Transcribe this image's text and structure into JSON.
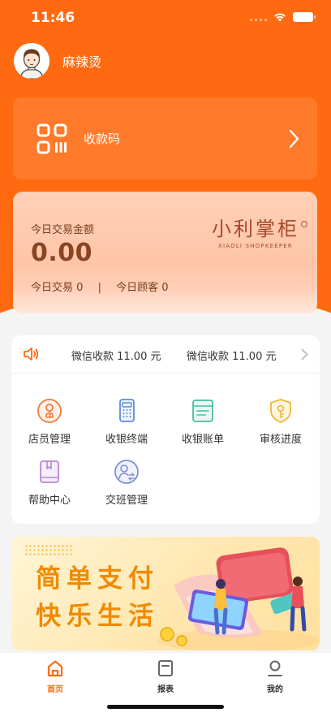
{
  "status_bar": {
    "time": "11:46"
  },
  "profile": {
    "name": "麻辣烫",
    "avatar_icon": "avatar-icon"
  },
  "qr_card": {
    "label": "收款码",
    "icon": "qr-code-icon"
  },
  "stats": {
    "amount_label": "今日交易金额",
    "amount": "0.00",
    "transactions_label": "今日交易",
    "transactions": "0",
    "customers_label": "今日顾客",
    "customers": "0",
    "separator": "|",
    "logo_cn": "小利掌柜",
    "logo_en": "XIAOLI SHOPKEEPER"
  },
  "notices": [
    "微信收款 11.00 元",
    "微信收款 11.00 元"
  ],
  "menu": [
    {
      "label": "店员管理",
      "icon": "staff-icon",
      "color": "#f07b3f"
    },
    {
      "label": "收银终端",
      "icon": "cashier-terminal-icon",
      "color": "#5b8fd8"
    },
    {
      "label": "收银账单",
      "icon": "bill-icon",
      "color": "#4dbba6"
    },
    {
      "label": "审核进度",
      "icon": "review-progress-icon",
      "color": "#f2b637"
    },
    {
      "label": "帮助中心",
      "icon": "help-book-icon",
      "color": "#b986d6"
    },
    {
      "label": "交班管理",
      "icon": "shift-handover-icon",
      "color": "#7d8fd6"
    }
  ],
  "banner": {
    "line1": "简单支付",
    "line2": "快乐生活"
  },
  "tabs": [
    {
      "label": "首页",
      "icon": "home-icon",
      "active": true
    },
    {
      "label": "报表",
      "icon": "report-icon",
      "active": false
    },
    {
      "label": "我的",
      "icon": "profile-icon",
      "active": false
    }
  ],
  "colors": {
    "primary": "#ff6a10",
    "background": "#f4f4f4"
  }
}
